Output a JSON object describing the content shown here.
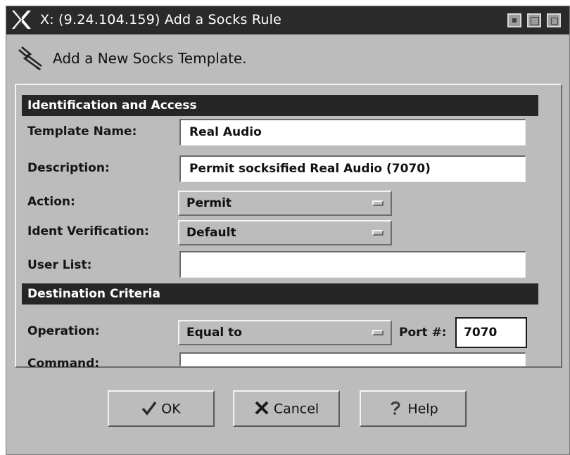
{
  "window": {
    "title": "X: (9.24.104.159) Add a Socks Rule",
    "x_icon": "x-logo-icon",
    "controls": [
      "minimize-icon",
      "maximize-icon",
      "close-icon"
    ]
  },
  "header": {
    "icon": "lightning-pencil-icon",
    "text": "Add a New Socks Template."
  },
  "sections": {
    "identification": {
      "title": "Identification and Access",
      "template_name_label": "Template Name:",
      "template_name_value": "Real Audio",
      "description_label": "Description:",
      "description_value": "Permit socksified Real Audio (7070)",
      "action_label": "Action:",
      "action_value": "Permit",
      "ident_label": "Ident Verification:",
      "ident_value": "Default",
      "user_list_label": "User List:",
      "user_list_value": ""
    },
    "destination": {
      "title": "Destination Criteria",
      "operation_label": "Operation:",
      "operation_value": "Equal to",
      "port_label": "Port #:",
      "port_value": "7070",
      "command_label": "Command:",
      "command_value": ""
    }
  },
  "buttons": {
    "ok": {
      "label": "OK",
      "icon": "checkmark-icon"
    },
    "cancel": {
      "label": "Cancel",
      "icon": "cancel-x-icon"
    },
    "help": {
      "label": "Help",
      "icon": "question-mark-icon"
    }
  },
  "colors": {
    "title_bar": "#2a2a2a",
    "section_bar": "#262626",
    "field_background": "#ffffff",
    "window_background": "#c9c9c9"
  }
}
